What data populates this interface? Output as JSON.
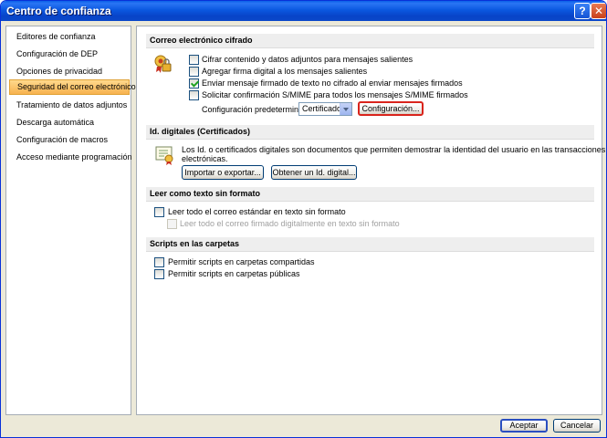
{
  "window": {
    "title": "Centro de confianza",
    "help_glyph": "?",
    "close_glyph": "✕"
  },
  "sidebar": {
    "items": [
      {
        "label": "Editores de confianza"
      },
      {
        "label": "Configuración de DEP"
      },
      {
        "label": "Opciones de privacidad"
      },
      {
        "label": "Seguridad del correo electrónico",
        "active": true
      },
      {
        "label": "Tratamiento de datos adjuntos"
      },
      {
        "label": "Descarga automática"
      },
      {
        "label": "Configuración de macros"
      },
      {
        "label": "Acceso mediante programación"
      }
    ]
  },
  "encrypted_mail": {
    "heading": "Correo electrónico cifrado",
    "options": [
      {
        "label": "Cifrar contenido y datos adjuntos para mensajes salientes",
        "checked": false
      },
      {
        "label": "Agregar firma digital a los mensajes salientes",
        "checked": false
      },
      {
        "label": "Enviar mensaje firmado de texto no cifrado al enviar mensajes firmados",
        "checked": true
      },
      {
        "label": "Solicitar confirmación S/MIME para todos los mensajes S/MIME firmados",
        "checked": false
      }
    ],
    "default_config_label": "Configuración predeterminada:",
    "default_config_value": "Certificado",
    "config_button": "Configuración..."
  },
  "digital_ids": {
    "heading": "Id. digitales (Certificados)",
    "description_line1": "Los Id. o certificados digitales son documentos que permiten demostrar la identidad del usuario en las transacciones",
    "description_line2": "electrónicas.",
    "import_button": "Importar o exportar...",
    "get_id_button": "Obtener un Id. digital..."
  },
  "plain_text": {
    "heading": "Leer como texto sin formato",
    "read_all_label": "Leer todo el correo estándar en texto sin formato",
    "read_all_checked": false,
    "read_signed_label": "Leer todo el correo firmado digitalmente en texto sin formato",
    "read_signed_checked": false
  },
  "scripts": {
    "heading": "Scripts en las carpetas",
    "shared_label": "Permitir scripts en carpetas compartidas",
    "shared_checked": false,
    "public_label": "Permitir scripts en carpetas públicas",
    "public_checked": false
  },
  "footer": {
    "ok": "Aceptar",
    "cancel": "Cancelar"
  },
  "colors": {
    "titlebar": "#0a47c9",
    "active_nav": "#f7b24f",
    "highlight_border": "#d9241c"
  }
}
